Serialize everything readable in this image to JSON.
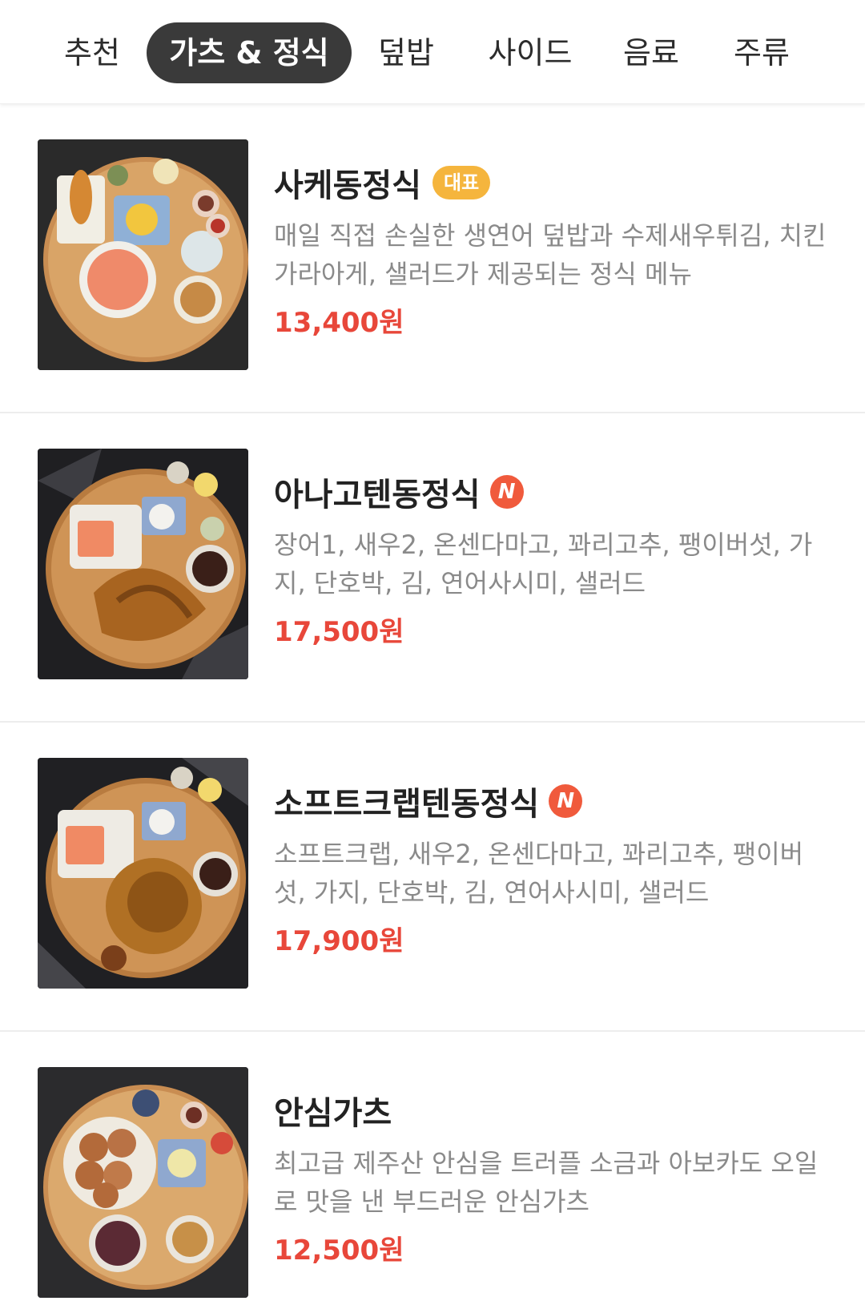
{
  "tabs": [
    {
      "label": "추천",
      "active": false
    },
    {
      "label": "가츠 & 정식",
      "active": true
    },
    {
      "label": "덮밥",
      "active": false
    },
    {
      "label": "사이드",
      "active": false
    },
    {
      "label": "음료",
      "active": false
    },
    {
      "label": "주류",
      "active": false
    }
  ],
  "menu": {
    "items": [
      {
        "name": "사케동정식",
        "badge": "대표",
        "description": "매일 직접 손실한 생연어 덮밥과 수제새우튀김, 치킨가라아게, 샐러드가 제공되는 정식 메뉴",
        "price": "13,400원"
      },
      {
        "name": "아나고텐동정식",
        "new_badge": "N",
        "description": "장어1, 새우2, 온센다마고, 꽈리고추, 팽이버섯, 가지, 단호박, 김, 연어사시미, 샐러드",
        "price": "17,500원"
      },
      {
        "name": "소프트크랩텐동정식",
        "new_badge": "N",
        "description": "소프트크랩, 새우2, 온센다마고, 꽈리고추, 팽이버섯, 가지, 단호박, 김, 연어사시미, 샐러드",
        "price": "17,900원"
      },
      {
        "name": "안심가츠",
        "description": "최고급 제주산 안심을 트러플 소금과 아보카도 오일로 맛을 낸 부드러운 안심가츠",
        "price": "12,500원"
      }
    ]
  },
  "colors": {
    "accent_price": "#e8473a",
    "badge_best": "#f5b53d",
    "badge_new": "#f05a3c",
    "active_tab": "#3a3a3a"
  }
}
